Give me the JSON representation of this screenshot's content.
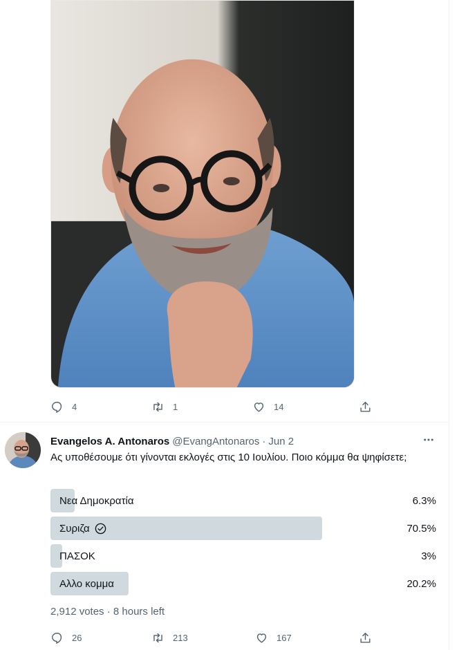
{
  "first_tweet": {
    "photo_icon": "portrait-photo",
    "actions": {
      "reply_count": "4",
      "retweet_count": "1",
      "like_count": "14"
    }
  },
  "poll_tweet": {
    "author_name": "Evangelos A. Antonaros",
    "author_handle": "@EvangAntonaros",
    "separator": "·",
    "date": "Jun 2",
    "text": "Ας υποθέσουμε ότι γίνονται εκλογές στις 10 Ιουλίου. Ποιο κόμμα θα ψηφίσετε;",
    "poll": {
      "options": [
        {
          "label": "Νεα Δημοκρατία",
          "percent_text": "6.3%",
          "percent": 6.3,
          "winner": false
        },
        {
          "label": "Συριζα",
          "percent_text": "70.5%",
          "percent": 70.5,
          "winner": true
        },
        {
          "label": "ΠΑΣΟΚ",
          "percent_text": "3%",
          "percent": 3,
          "winner": false
        },
        {
          "label": "Αλλο κομμα",
          "percent_text": "20.2%",
          "percent": 20.2,
          "winner": false
        }
      ],
      "meta": "2,912 votes · 8 hours left"
    },
    "actions": {
      "reply_count": "26",
      "retweet_count": "213",
      "like_count": "167"
    }
  },
  "colors": {
    "text": "#0f1419",
    "secondary": "#536471",
    "poll_bar": "#cfd9de",
    "divider": "#eff3f4"
  }
}
